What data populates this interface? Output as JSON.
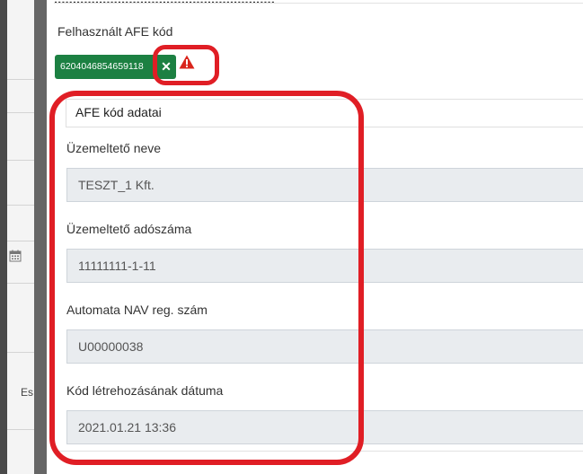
{
  "left": {
    "cut_text": "Es"
  },
  "top_cut_text": "...........................................................",
  "afe": {
    "label": "Felhasznált AFE kód",
    "code": "6204046854659118",
    "remove_icon": "close-icon",
    "warning_icon": "warning-icon"
  },
  "section": {
    "title": "AFE kód adatai",
    "fields": [
      {
        "label": "Üzemeltető neve",
        "value": "TESZT_1 Kft."
      },
      {
        "label": "Üzemeltető adószáma",
        "value": "11111111-1-11"
      },
      {
        "label": "Automata NAV reg. szám",
        "value": "U00000038"
      },
      {
        "label": "Kód létrehozásának dátuma",
        "value": "2021.01.21 13:36"
      }
    ]
  },
  "colors": {
    "accent": "#1c8042",
    "highlight": "#e01e25",
    "warning": "#d9251c"
  }
}
